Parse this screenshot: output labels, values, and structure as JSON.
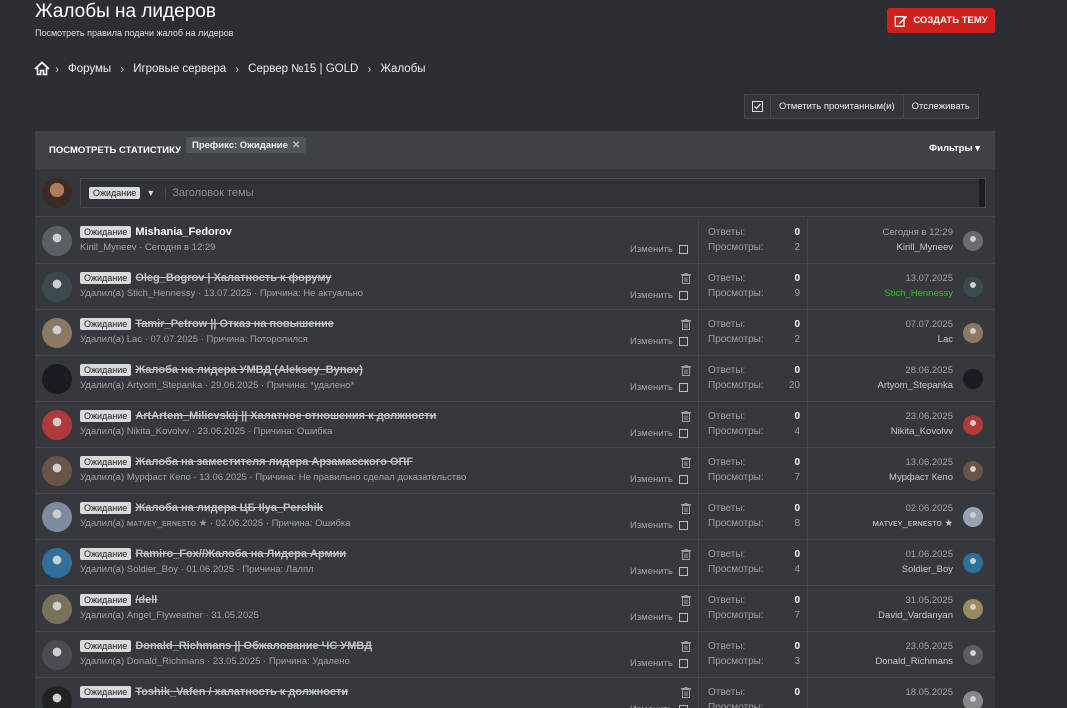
{
  "header": {
    "title": "Жалобы на лидеров",
    "description": "Посмотреть правила подачи жалоб на лидеров",
    "create_button": "СОЗДАТЬ ТЕМУ"
  },
  "breadcrumb": [
    "Форумы",
    "Игровые сервера",
    "Сервер №15 | GOLD",
    "Жалобы"
  ],
  "toolbar": {
    "mark_read": "Отметить прочитанным(и)",
    "watch": "Отслеживать"
  },
  "filterbar": {
    "stats": "ПОСМОТРЕТЬ СТАТИСТИКУ",
    "prefix_filter": "Префикс: Ожидание",
    "filters": "Фильтры"
  },
  "new_thread": {
    "prefix": "Ожидание",
    "placeholder": "Заголовок темы"
  },
  "labels": {
    "replies": "Ответы:",
    "views": "Просмотры:",
    "edit": "Изменить"
  },
  "colors": {
    "accent_red": "#d0201b",
    "green_user": "#3fbf1f"
  },
  "threads": [
    {
      "prefix": "Ожидание",
      "title": "Mishania_Fedorov",
      "deleted": false,
      "meta": "Kirill_Myneev · Сегодня в 12:29",
      "replies": "0",
      "views": "2",
      "last_date": "Сегодня в 12:29",
      "last_user": "Kirill_Myneev",
      "green": false,
      "av": "#5b5f66",
      "lav": "#6e6a70"
    },
    {
      "prefix": "Ожидание",
      "title": "Oleg_Bogrov | Халатность к форуму",
      "deleted": true,
      "meta": "Удалил(а) Stich_Hennessy · 13.07.2025 · Причина: Не актуально",
      "replies": "0",
      "views": "9",
      "last_date": "13.07.2025",
      "last_user": "Stich_Hennessy",
      "green": true,
      "av": "#3c4a4f",
      "lav": "#3c4a4f"
    },
    {
      "prefix": "Ожидание",
      "title": "Tamir_Petrow || Отказ на повышение",
      "deleted": true,
      "meta": "Удалил(а) Lac · 07.07.2025 · Причина: Поторопился",
      "replies": "0",
      "views": "2",
      "last_date": "07.07.2025",
      "last_user": "Lac",
      "green": false,
      "av": "#8a7a63",
      "lav": "#8a7a63"
    },
    {
      "prefix": "Ожидание",
      "title": "Жалоба на лидера УМВД (Aleksey_Bynov)",
      "deleted": true,
      "meta": "Удалил(а) Artyom_Stepanka · 29.06.2025 · Причина: *удалено*",
      "replies": "0",
      "views": "20",
      "last_date": "28.06.2025",
      "last_user": "Artyom_Stepanka",
      "green": false,
      "av": "#1c1a22",
      "lav": "#1c1a22"
    },
    {
      "prefix": "Ожидание",
      "title": "ArtArtem_Milicvskij || Халатное отношения к должности",
      "deleted": true,
      "meta": "Удалил(а) Nikita_Kovolvv · 23.06.2025 · Причина: Ошибка",
      "replies": "0",
      "views": "4",
      "last_date": "23.06.2025",
      "last_user": "Nikita_Kovolvv",
      "green": false,
      "av": "#b03a3a",
      "lav": "#b03a3a"
    },
    {
      "prefix": "Ожидание",
      "title": "Жалоба на заместителя лидера Арзамасского ОПГ",
      "deleted": true,
      "meta": "Удалил(а) Мурфаст Кепо · 13.06.2025 · Причина: Не правильно сделал доказательство",
      "replies": "0",
      "views": "7",
      "last_date": "13.06.2025",
      "last_user": "Мурфаст Кепо",
      "green": false,
      "av": "#6a5446",
      "lav": "#6a5446"
    },
    {
      "prefix": "Ожидание",
      "title": "Жалоба на лидера ЦБ Ilya_Perchik",
      "deleted": true,
      "meta": "Удалил(а) ᴍᴀᴛᴠᴇʏ_ᴇʀɴᴇsᴛᴏ ★ · 02.06.2025 · Причина: Ошибка",
      "replies": "0",
      "views": "8",
      "last_date": "02.06.2025",
      "last_user": "ᴍᴀᴛᴠᴇʏ_ᴇʀɴᴇsᴛᴏ ★",
      "green": false,
      "av": "#7d8aa0",
      "lav": "#9aa3b5"
    },
    {
      "prefix": "Ожидание",
      "title": "Ramiro_Fox//Жалоба на Лидера Армии",
      "deleted": true,
      "meta": "Удалил(а) Soldier_Boy · 01.06.2025 · Причина: Лалпл",
      "replies": "0",
      "views": "4",
      "last_date": "01.06.2025",
      "last_user": "Soldier_Boy",
      "green": false,
      "av": "#2f6f9a",
      "lav": "#2f6f9a"
    },
    {
      "prefix": "Ожидание",
      "title": "/dell",
      "deleted": true,
      "meta": "Удалил(а) Angel_Flyweather · 31.05.2025",
      "replies": "0",
      "views": "7",
      "last_date": "31.05.2025",
      "last_user": "David_Vardanyan",
      "green": false,
      "av": "#7a7258",
      "lav": "#9a8a62"
    },
    {
      "prefix": "Ожидание",
      "title": "Donald_Richmans || Обжалование ЧС УМВД",
      "deleted": true,
      "meta": "Удалил(а) Donald_Richmans · 23.05.2025 · Причина: Удалено",
      "replies": "0",
      "views": "3",
      "last_date": "23.05.2025",
      "last_user": "Donald_Richmans",
      "green": false,
      "av": "#4a4e54",
      "lav": "#5a5e64"
    },
    {
      "prefix": "Ожидание",
      "title": "Toshik_Vafen / халатность к должности",
      "deleted": true,
      "meta": "",
      "replies": "0",
      "views": "",
      "last_date": "18.05.2025",
      "last_user": "",
      "green": false,
      "av": "#222",
      "lav": "#888"
    }
  ]
}
